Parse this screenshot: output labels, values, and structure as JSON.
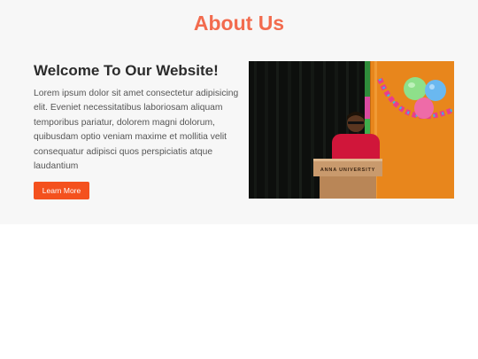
{
  "about": {
    "title": "About Us",
    "heading": "Welcome To Our Website!",
    "body": "Lorem ipsum dolor sit amet consectetur adipisicing elit. Eveniet necessitatibus laboriosam aliquam temporibus pariatur, dolorem magni dolorum, quibusdam optio veniam maxime et mollitia velit consequatur adipisci quos perspiciatis atque laudantium",
    "button_label": "Learn More",
    "photo": {
      "podium_text": "ANNA UNIVERSITY"
    }
  },
  "colors": {
    "accent": "#f26b4e",
    "button": "#f4511e",
    "section_bg": "#f7f7f7"
  }
}
